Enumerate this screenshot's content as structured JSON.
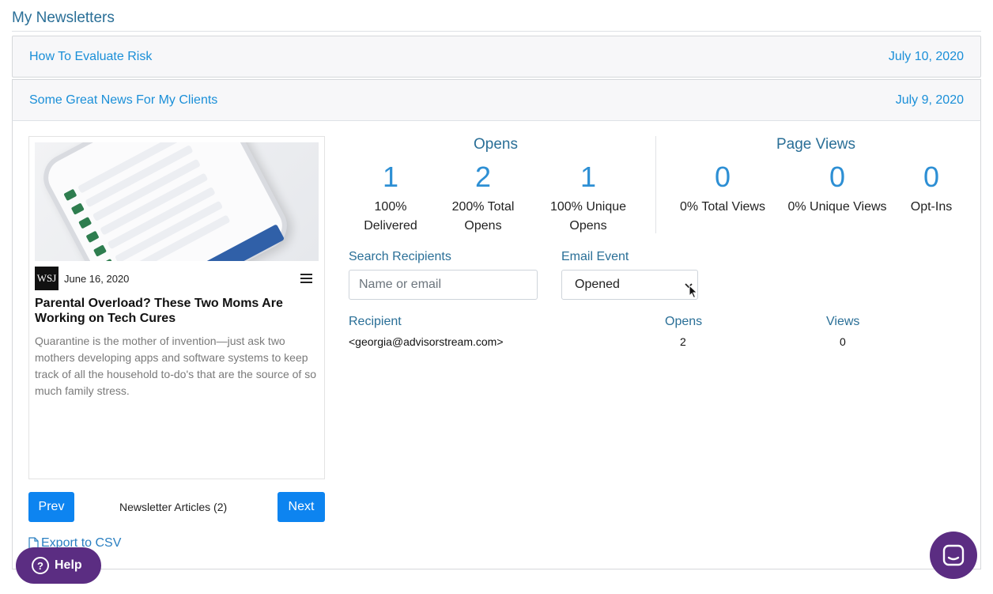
{
  "page": {
    "title": "My Newsletters"
  },
  "newsletters": [
    {
      "title": "How To Evaluate Risk",
      "date": "July 10, 2020"
    },
    {
      "title": "Some Great News For My Clients",
      "date": "July 9, 2020"
    }
  ],
  "article": {
    "source_logo": "WSJ",
    "date": "June 16, 2020",
    "title": "Parental Overload? These Two Moms Are Working on Tech Cures",
    "description": "Quarantine is the mother of invention—just ask two mothers developing apps and software systems to keep track of all the household to-do's that are the source of so much family stress."
  },
  "pager": {
    "prev_label": "Prev",
    "next_label": "Next",
    "count_label": "Newsletter Articles (2)"
  },
  "opens": {
    "title": "Opens",
    "stats": [
      {
        "value": "1",
        "label_line1": "100%",
        "label_line2": "Delivered"
      },
      {
        "value": "2",
        "label_line1": "200% Total",
        "label_line2": "Opens"
      },
      {
        "value": "1",
        "label_line1": "100% Unique",
        "label_line2": "Opens"
      }
    ]
  },
  "page_views": {
    "title": "Page Views",
    "stats": [
      {
        "value": "0",
        "label": "0% Total Views"
      },
      {
        "value": "0",
        "label": "0% Unique Views"
      },
      {
        "value": "0",
        "label": "Opt-Ins"
      }
    ]
  },
  "filters": {
    "search_label": "Search Recipients",
    "search_placeholder": "Name or email",
    "event_label": "Email Event",
    "event_selected": "Opened"
  },
  "recipients": {
    "headers": {
      "recipient": "Recipient",
      "opens": "Opens",
      "views": "Views"
    },
    "rows": [
      {
        "recipient": "<georgia@advisorstream.com>",
        "opens": "2",
        "views": "0"
      }
    ]
  },
  "export_label": "Export to CSV",
  "help_label": "Help",
  "colors": {
    "accent": "#0d84f0",
    "link": "#1a8fd8",
    "heading": "#2a6f97",
    "help_bg": "#5b2d82"
  }
}
